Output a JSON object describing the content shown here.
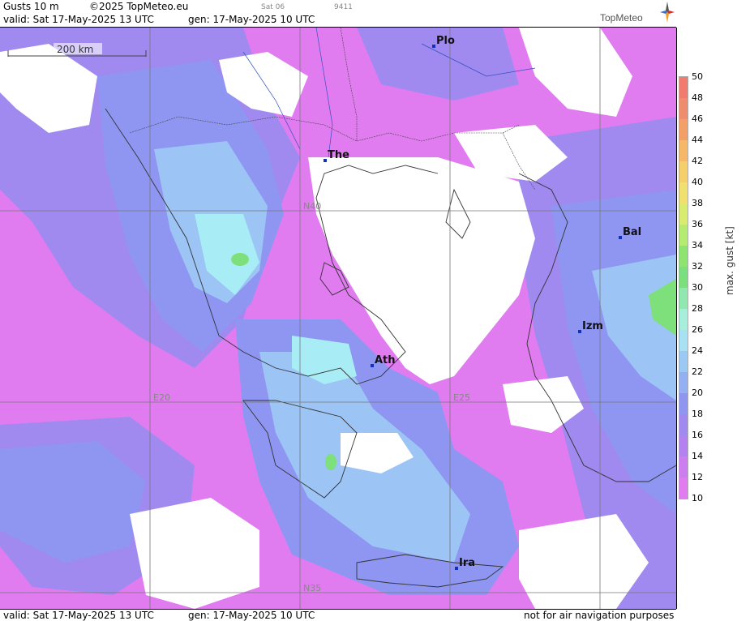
{
  "header": {
    "product": "Gusts 10 m",
    "copyright": "©2025 TopMeteo.eu",
    "run_label": "Sat 06",
    "run_code": "9411",
    "valid": "valid:  Sat  17-May-2025  13 UTC",
    "generated": "gen: 17-May-2025 10 UTC",
    "brand": "TopMeteo"
  },
  "footer": {
    "valid": "valid:  Sat  17-May-2025  13 UTC",
    "generated": "gen: 17-May-2025 10 UTC",
    "disclaimer": "not for air navigation purposes"
  },
  "map": {
    "scale_label": "200 km",
    "grid_labels": {
      "lat_north": "N40",
      "lat_south": "N35",
      "lon_west": "E20",
      "lon_east": "E25"
    },
    "cities": [
      {
        "id": "plo",
        "label": "Plo"
      },
      {
        "id": "the",
        "label": "The"
      },
      {
        "id": "bal",
        "label": "Bal"
      },
      {
        "id": "izm",
        "label": "Izm"
      },
      {
        "id": "ath",
        "label": "Ath"
      },
      {
        "id": "ira",
        "label": "Ira"
      }
    ],
    "colors": {
      "white": "#ffffff",
      "magenta": "#e07cf0",
      "violet": "#b482f0",
      "blue": "#8f96f2",
      "lightblue": "#9cc4f4",
      "cyan": "#a8ecf6",
      "green": "#7de07a"
    }
  },
  "legend": {
    "unit": "max. gust  [kt]",
    "ticks": [
      "50",
      "48",
      "46",
      "44",
      "42",
      "40",
      "38",
      "36",
      "34",
      "32",
      "30",
      "28",
      "26",
      "24",
      "22",
      "20",
      "18",
      "16",
      "14",
      "12",
      "10"
    ],
    "colors": [
      "#f07b6e",
      "#f08c6e",
      "#f2a068",
      "#f4b868",
      "#f4cf6c",
      "#f0e070",
      "#d8ec70",
      "#b4ec72",
      "#8ee470",
      "#7ae07e",
      "#90e8b0",
      "#a8eedc",
      "#a8e0f4",
      "#9cc8f4",
      "#94b0f2",
      "#8f96f2",
      "#a08af0",
      "#b482f0",
      "#cc7ef0",
      "#e07cf0"
    ]
  }
}
